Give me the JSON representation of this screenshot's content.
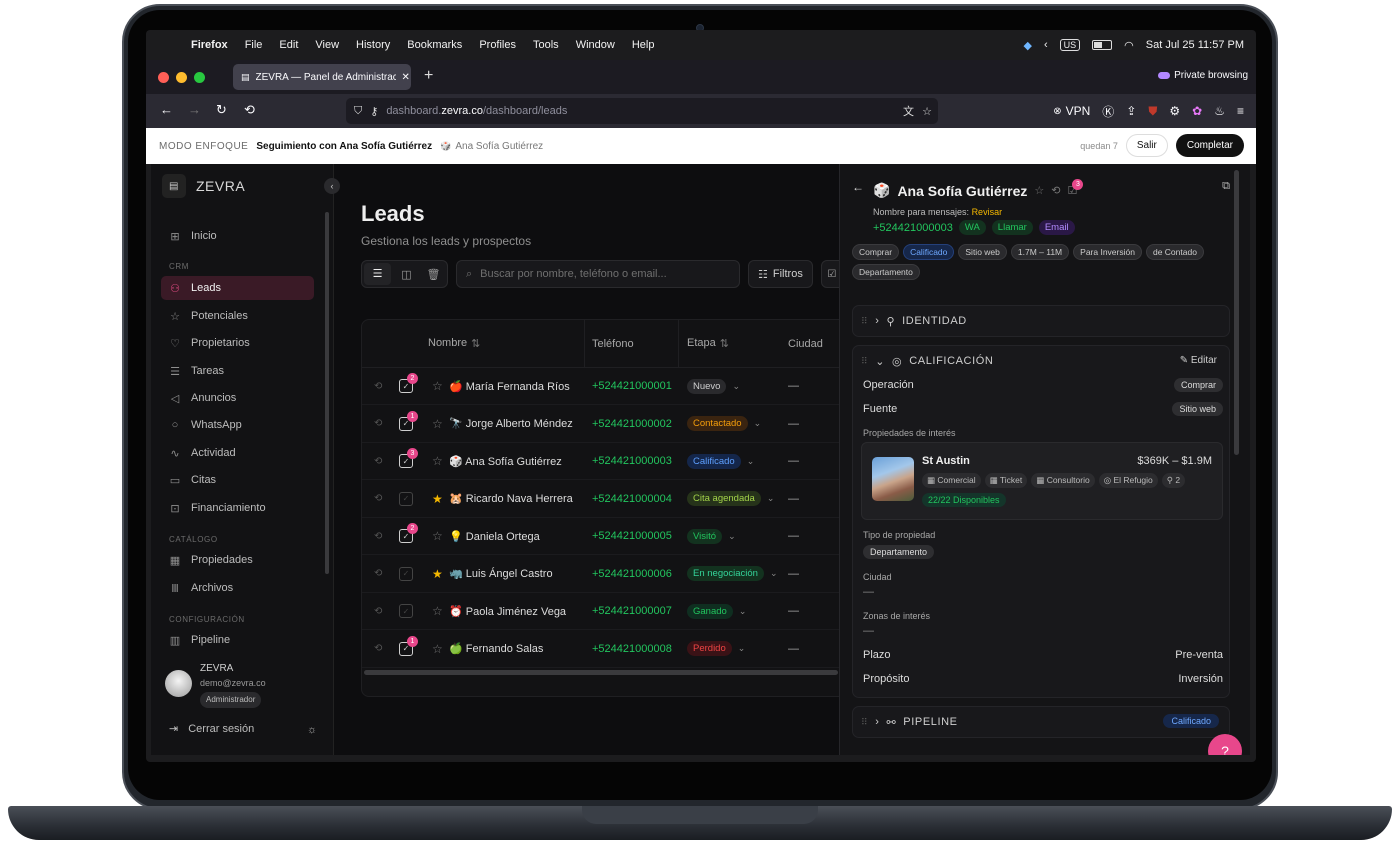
{
  "menubar": {
    "app": "Firefox",
    "items": [
      "File",
      "Edit",
      "View",
      "History",
      "Bookmarks",
      "Profiles",
      "Tools",
      "Window",
      "Help"
    ],
    "keyboard": "US",
    "datetime": "Sat Jul 25  11:57 PM"
  },
  "browser": {
    "tab_title": "ZEVRA — Panel de Administración",
    "private_label": "Private browsing",
    "url_prefix": "dashboard.",
    "url_host": "zevra.co",
    "url_path": "/dashboard/leads",
    "vpn_label": "VPN"
  },
  "focus": {
    "tag": "MODO ENFOQUE",
    "title": "Seguimiento con Ana Sofía Gutiérrez",
    "subtitle": "Ana Sofía Gutiérrez",
    "remaining": "quedan 7",
    "exit": "Salir",
    "complete": "Completar"
  },
  "sidebar": {
    "brand": "ZEVRA",
    "home": "Inicio",
    "section_crm": "CRM",
    "crm_items": [
      "Leads",
      "Potenciales",
      "Propietarios",
      "Tareas",
      "Anuncios",
      "WhatsApp",
      "Actividad",
      "Citas",
      "Financiamiento"
    ],
    "section_catalog": "CATÁLOGO",
    "catalog_items": [
      "Propiedades",
      "Archivos"
    ],
    "section_config": "CONFIGURACIÓN",
    "config_items": [
      "Pipeline"
    ],
    "user_name": "ZEVRA",
    "user_email": "demo@zevra.co",
    "user_role": "Administrador",
    "logout": "Cerrar sesión"
  },
  "main": {
    "title": "Leads",
    "subtitle": "Gestiona los leads y prospectos",
    "search_placeholder": "Buscar por nombre, teléfono o email...",
    "filters": "Filtros",
    "columns": [
      "Nombre",
      "Teléfono",
      "Etapa",
      "Ciudad"
    ],
    "rows": [
      {
        "emoji": "🍎",
        "name": "María Fernanda Ríos",
        "phone": "+524421000001",
        "stage": "Nuevo",
        "city": "—",
        "tasks": "2",
        "starred": false
      },
      {
        "emoji": "🔭",
        "name": "Jorge Alberto Méndez",
        "phone": "+524421000002",
        "stage": "Contactado",
        "city": "—",
        "tasks": "1",
        "starred": false
      },
      {
        "emoji": "🎲",
        "name": "Ana Sofía Gutiérrez",
        "phone": "+524421000003",
        "stage": "Calificado",
        "city": "—",
        "tasks": "3",
        "starred": false
      },
      {
        "emoji": "🐹",
        "name": "Ricardo Nava Herrera",
        "phone": "+524421000004",
        "stage": "Cita agendada",
        "city": "—",
        "tasks": "",
        "starred": true
      },
      {
        "emoji": "💡",
        "name": "Daniela Ortega",
        "phone": "+524421000005",
        "stage": "Visitó",
        "city": "—",
        "tasks": "2",
        "starred": false
      },
      {
        "emoji": "🦏",
        "name": "Luis Ángel Castro",
        "phone": "+524421000006",
        "stage": "En negociación",
        "city": "—",
        "tasks": "",
        "starred": true
      },
      {
        "emoji": "⏰",
        "name": "Paola Jiménez Vega",
        "phone": "+524421000007",
        "stage": "Ganado",
        "city": "—",
        "tasks": "",
        "starred": false
      },
      {
        "emoji": "🍏",
        "name": "Fernando Salas",
        "phone": "+524421000008",
        "stage": "Perdido",
        "city": "—",
        "tasks": "1",
        "starred": false
      }
    ]
  },
  "stage_colors": {
    "Nuevo": [
      "#2a2a2d",
      "#cfcfcf"
    ],
    "Contactado": [
      "#3a2410",
      "#f59e0b"
    ],
    "Calificado": [
      "#14264a",
      "#5ea0ff"
    ],
    "Cita agendada": [
      "#26331a",
      "#a3d34a"
    ],
    "Visitó": [
      "#13321f",
      "#22c55e"
    ],
    "En negociación": [
      "#13321f",
      "#34d399"
    ],
    "Ganado": [
      "#0f2e20",
      "#22c55e"
    ],
    "Perdido": [
      "#3a1216",
      "#ef4444"
    ]
  },
  "panel": {
    "emoji": "🎲",
    "name": "Ana Sofía Gutiérrez",
    "task_count": "3",
    "msg_label": "Nombre para mensajes:",
    "msg_value": "Revisar",
    "phone": "+524421000003",
    "wa": "WA",
    "call": "Llamar",
    "email": "Email",
    "tags": [
      "Comprar",
      "Calificado",
      "Sitio web",
      "1.7M – 11M",
      "Para Inversión",
      "de Contado",
      "Departamento"
    ],
    "identity": "IDENTIDAD",
    "qualification": "CALIFICACIÓN",
    "edit": "Editar",
    "operation_label": "Operación",
    "operation_value": "Comprar",
    "source_label": "Fuente",
    "source_value": "Sitio web",
    "props_label": "Propiedades de interés",
    "prop_name": "St Austin",
    "prop_price": "$369K – $1.9M",
    "prop_tags": [
      "Comercial",
      "Ticket",
      "Consultorio",
      "El Refugio",
      "2"
    ],
    "prop_available": "22/22 Disponibles",
    "type_label": "Tipo de propiedad",
    "type_value": "Departamento",
    "city_label": "Ciudad",
    "city_value": "—",
    "zones_label": "Zonas de interés",
    "zones_value": "—",
    "term_label": "Plazo",
    "term_value": "Pre-venta",
    "purpose_label": "Propósito",
    "purpose_value": "Inversión",
    "pipeline": "PIPELINE",
    "pipeline_value": "Calificado"
  }
}
